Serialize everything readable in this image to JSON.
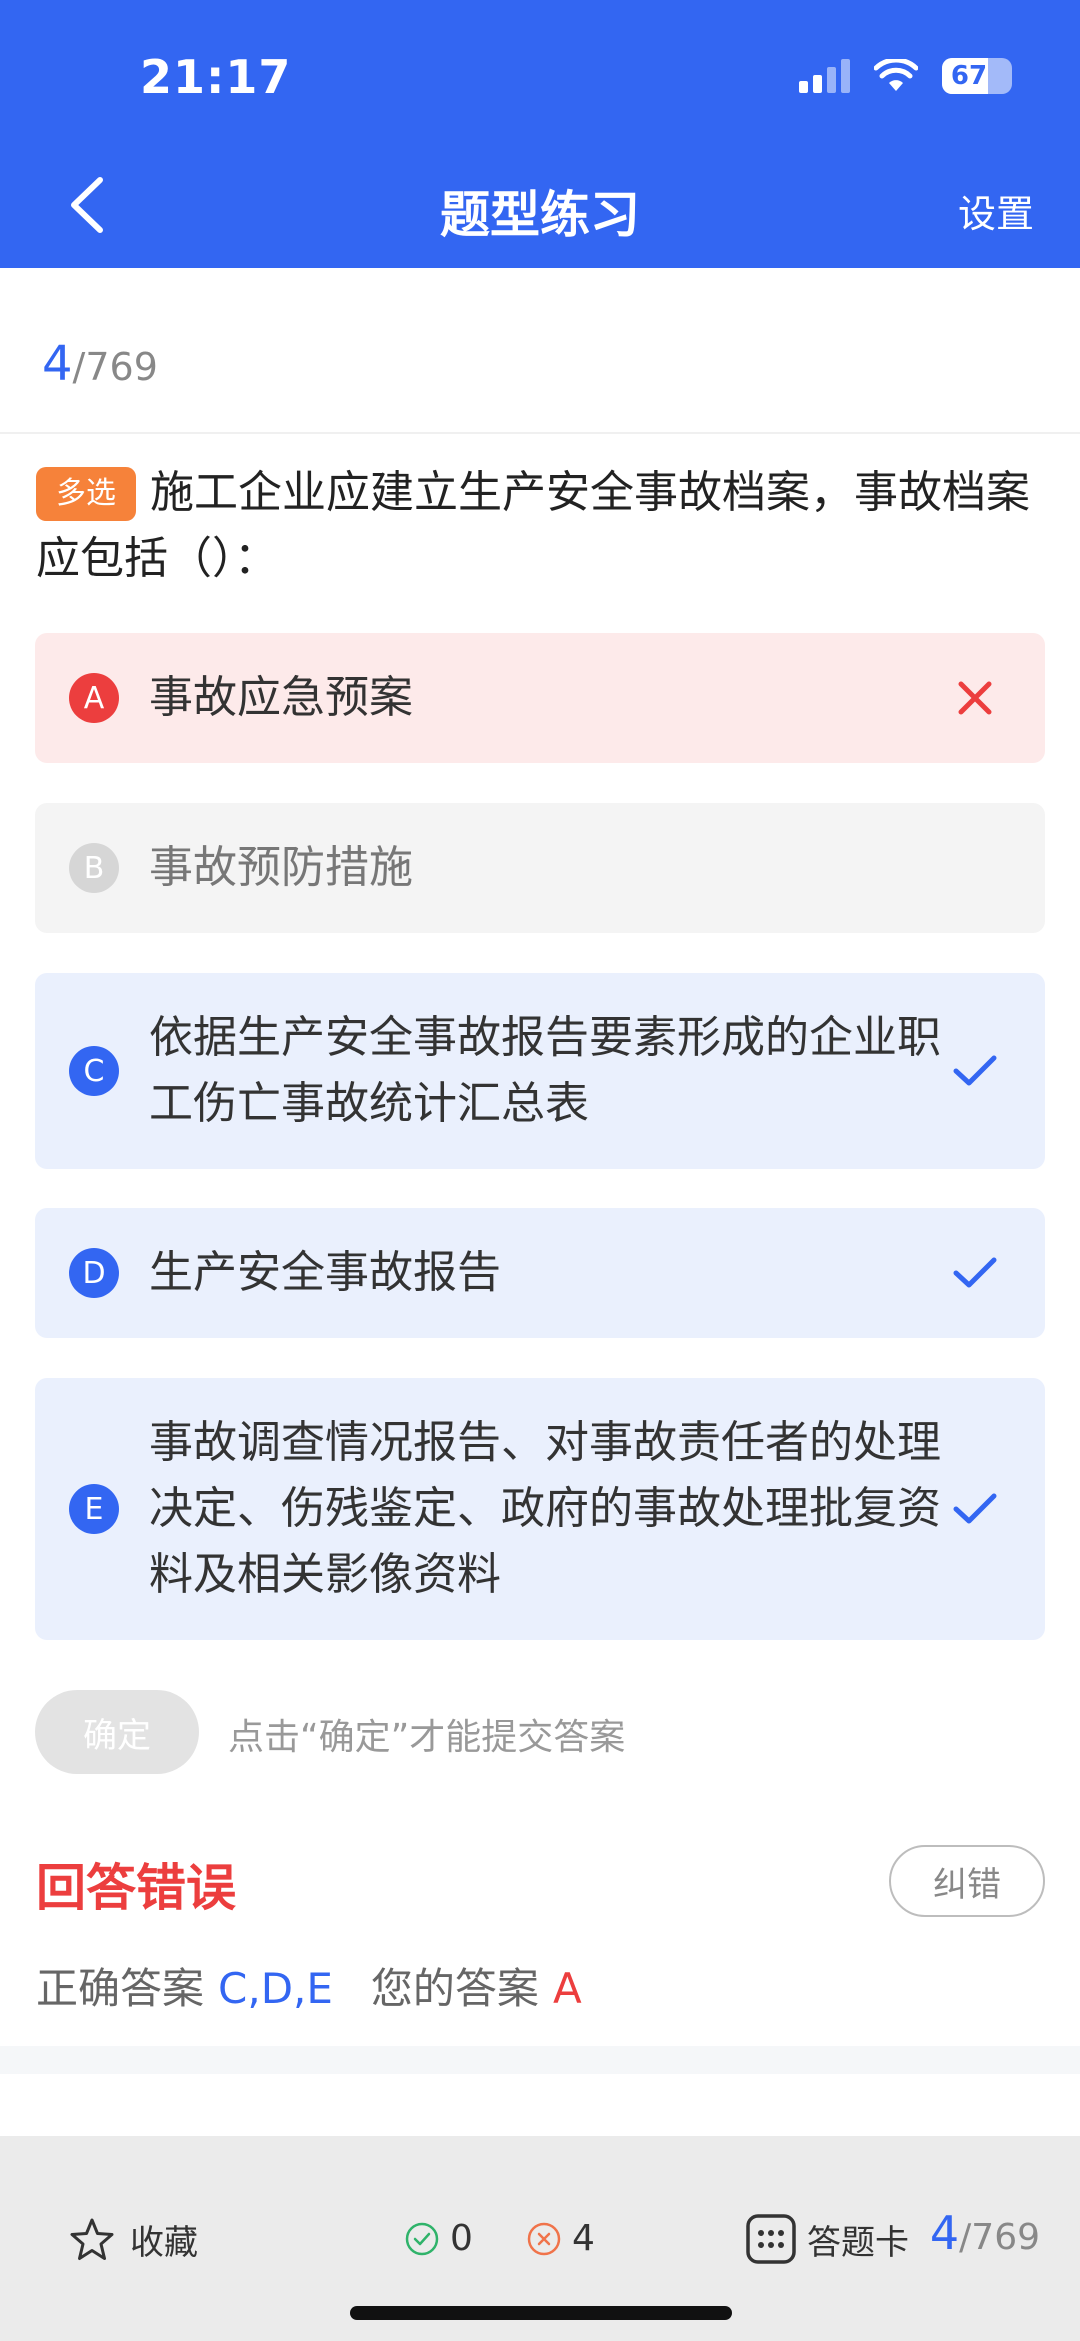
{
  "status": {
    "time": "21:17",
    "battery": "67"
  },
  "nav": {
    "title": "题型练习",
    "settings": "设置"
  },
  "progress": {
    "current": "4",
    "total": "/769"
  },
  "question": {
    "tag": "多选",
    "text": "施工企业应建立生产安全事故档案，事故档案应包括（）："
  },
  "options": [
    {
      "letter": "A",
      "text": "事故应急预案",
      "state": "wrong"
    },
    {
      "letter": "B",
      "text": "事故预防措施",
      "state": "neutral"
    },
    {
      "letter": "C",
      "text": "依据生产安全事故报告要素形成的企业职工伤亡事故统计汇总表",
      "state": "correct"
    },
    {
      "letter": "D",
      "text": "生产安全事故报告",
      "state": "correct"
    },
    {
      "letter": "E",
      "text": "事故调查情况报告、对事故责任者的处理决定、伤残鉴定、政府的事故处理批复资料及相关影像资料",
      "state": "correct"
    }
  ],
  "confirm": {
    "label": "确定",
    "hint": "点击“确定”才能提交答案"
  },
  "result": {
    "title": "回答错误",
    "report": "纠错",
    "correct_label": "正确答案",
    "correct_value": "C,D,E",
    "your_label": "您的答案",
    "your_value": "A"
  },
  "bottom": {
    "favorite": "收藏",
    "right_count": "0",
    "wrong_count": "4",
    "answer_card": "答题卡",
    "current": "4",
    "total": "/769"
  },
  "colors": {
    "primary": "#3366f2",
    "error": "#ec3e3e",
    "tag": "#f6823a"
  }
}
